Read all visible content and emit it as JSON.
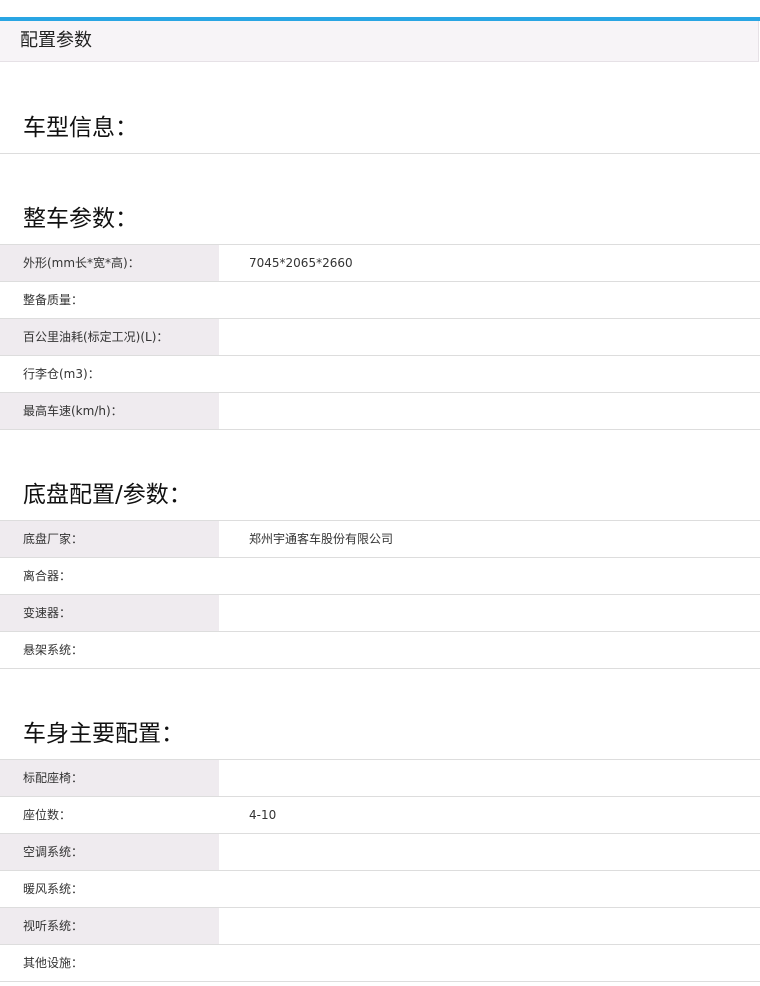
{
  "header": {
    "title": "配置参数"
  },
  "sections": [
    {
      "title": "车型信息：",
      "rows": []
    },
    {
      "title": "整车参数：",
      "rows": [
        {
          "label": "外形(mm长*宽*高)：",
          "value": "7045*2065*2660"
        },
        {
          "label": "整备质量：",
          "value": ""
        },
        {
          "label": "百公里油耗(标定工况)(L)：",
          "value": ""
        },
        {
          "label": "行李仓(m3)：",
          "value": ""
        },
        {
          "label": "最高车速(km/h)：",
          "value": ""
        }
      ]
    },
    {
      "title": "底盘配置/参数：",
      "rows": [
        {
          "label": "底盘厂家：",
          "value": "郑州宇通客车股份有限公司"
        },
        {
          "label": "离合器：",
          "value": ""
        },
        {
          "label": "变速器：",
          "value": ""
        },
        {
          "label": "悬架系统：",
          "value": ""
        }
      ]
    },
    {
      "title": "车身主要配置：",
      "rows": [
        {
          "label": "标配座椅：",
          "value": ""
        },
        {
          "label": "座位数：",
          "value": "4-10"
        },
        {
          "label": "空调系统：",
          "value": ""
        },
        {
          "label": "暖风系统：",
          "value": ""
        },
        {
          "label": "视听系统：",
          "value": ""
        },
        {
          "label": "其他设施：",
          "value": ""
        }
      ]
    }
  ]
}
